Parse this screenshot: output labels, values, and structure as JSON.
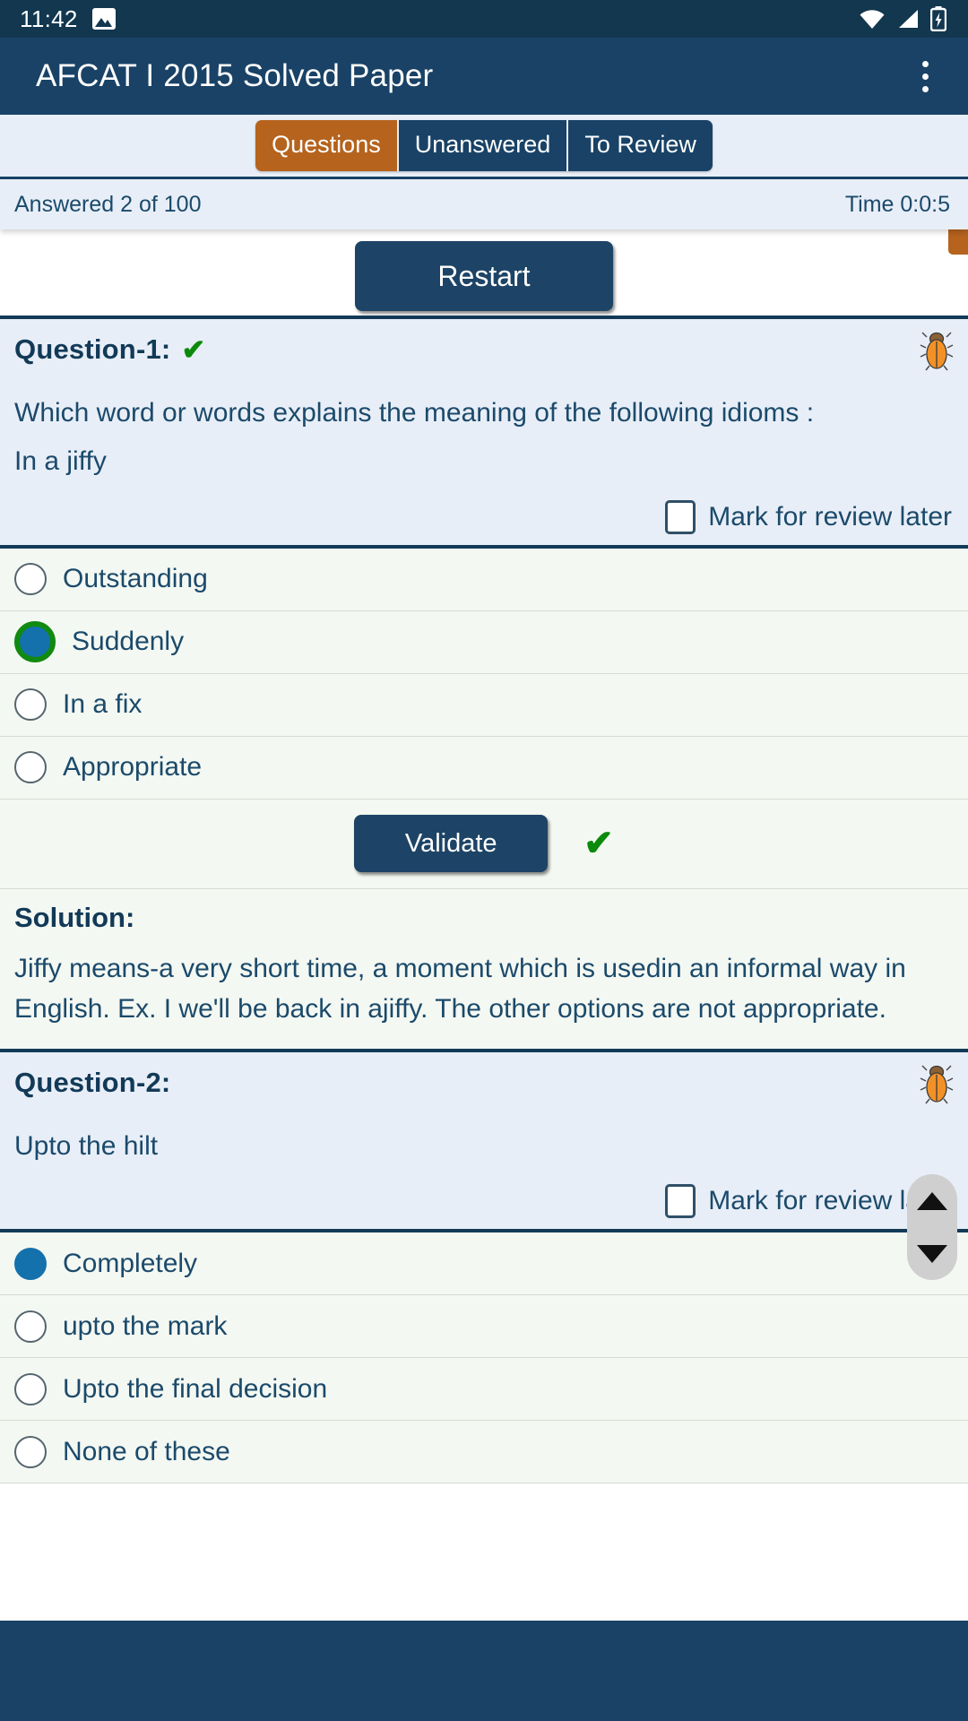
{
  "status_bar": {
    "time": "11:42",
    "icons": [
      "screenshot-image-icon",
      "wifi-icon",
      "cellular-signal-icon",
      "battery-charging-icon"
    ]
  },
  "app_bar": {
    "title": "AFCAT I 2015 Solved Paper",
    "overflow_menu": "overflow-menu-icon"
  },
  "tabs": [
    {
      "label": "Questions",
      "active": true
    },
    {
      "label": "Unanswered",
      "active": false
    },
    {
      "label": "To Review",
      "active": false
    }
  ],
  "status_row": {
    "answered": "Answered 2 of 100",
    "time": "Time 0:0:5"
  },
  "restart_button": "Restart",
  "questions": [
    {
      "label": "Question-1:",
      "status_tick": "✔",
      "bug_icon": "bug-report-icon",
      "prompt_line1": "Which word or words explains the meaning of the following idioms :",
      "prompt_line2": "In a jiffy",
      "mark_review_label": "Mark for review later",
      "mark_review_checked": false,
      "options": [
        {
          "label": "Outstanding",
          "state": "unselected"
        },
        {
          "label": "Suddenly",
          "state": "selected-correct"
        },
        {
          "label": "In a fix",
          "state": "unselected"
        },
        {
          "label": "Appropriate",
          "state": "unselected"
        }
      ],
      "validate_button": "Validate",
      "validate_tick": "✔",
      "solution_title": "Solution:",
      "solution_text": "Jiffy means-a very short time, a moment which is usedin an informal way in English. Ex. I we'll be back in ajiffy. The other options are not appropriate."
    },
    {
      "label": "Question-2:",
      "status_tick": "",
      "bug_icon": "bug-report-icon",
      "prompt_line1": "Upto the hilt",
      "prompt_line2": "",
      "mark_review_label": "Mark for review later",
      "mark_review_checked": false,
      "options": [
        {
          "label": "Completely",
          "state": "selected"
        },
        {
          "label": "upto the mark",
          "state": "unselected"
        },
        {
          "label": "Upto the final decision",
          "state": "unselected"
        },
        {
          "label": "None of these",
          "state": "unselected"
        }
      ]
    }
  ],
  "scroll_widget": {
    "up": "scroll-up-icon",
    "down": "scroll-down-icon"
  },
  "colors": {
    "appbar": "#194266",
    "statusbar": "#12374f",
    "active_tab": "#b5631d",
    "inactive_tab": "#194266",
    "question_bg": "#e8eef7",
    "option_bg": "#f4f8f2",
    "text": "#1b4a6b",
    "correct_green": "#118a11",
    "selected_blue": "#1471ab"
  }
}
